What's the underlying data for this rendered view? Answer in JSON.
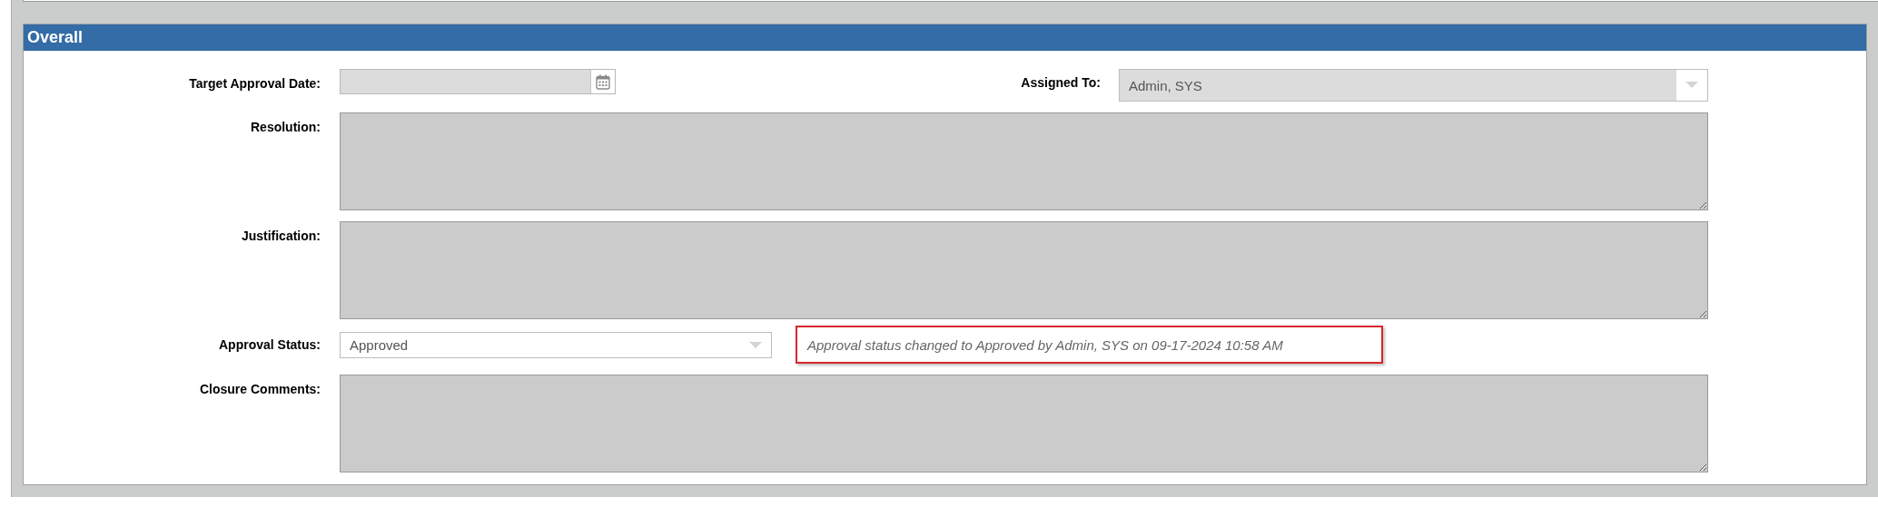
{
  "panel_title": "Overall",
  "target_approval_date": {
    "label": "Target Approval Date:",
    "disabled": true
  },
  "assigned_to": {
    "label": "Assigned To:",
    "value": "Admin, SYS",
    "disabled": true
  },
  "text_areas": [
    {
      "label": "Resolution:",
      "disabled": true
    },
    {
      "label": "Justification:",
      "disabled": true
    }
  ],
  "approval_status": {
    "label": "Approval Status:",
    "value": "Approved",
    "disabled": false,
    "note": "Approval status changed to Approved by Admin, SYS on 09-17-2024 10:58 AM"
  },
  "closure_comments": {
    "label": "Closure Comments:",
    "disabled": true
  }
}
